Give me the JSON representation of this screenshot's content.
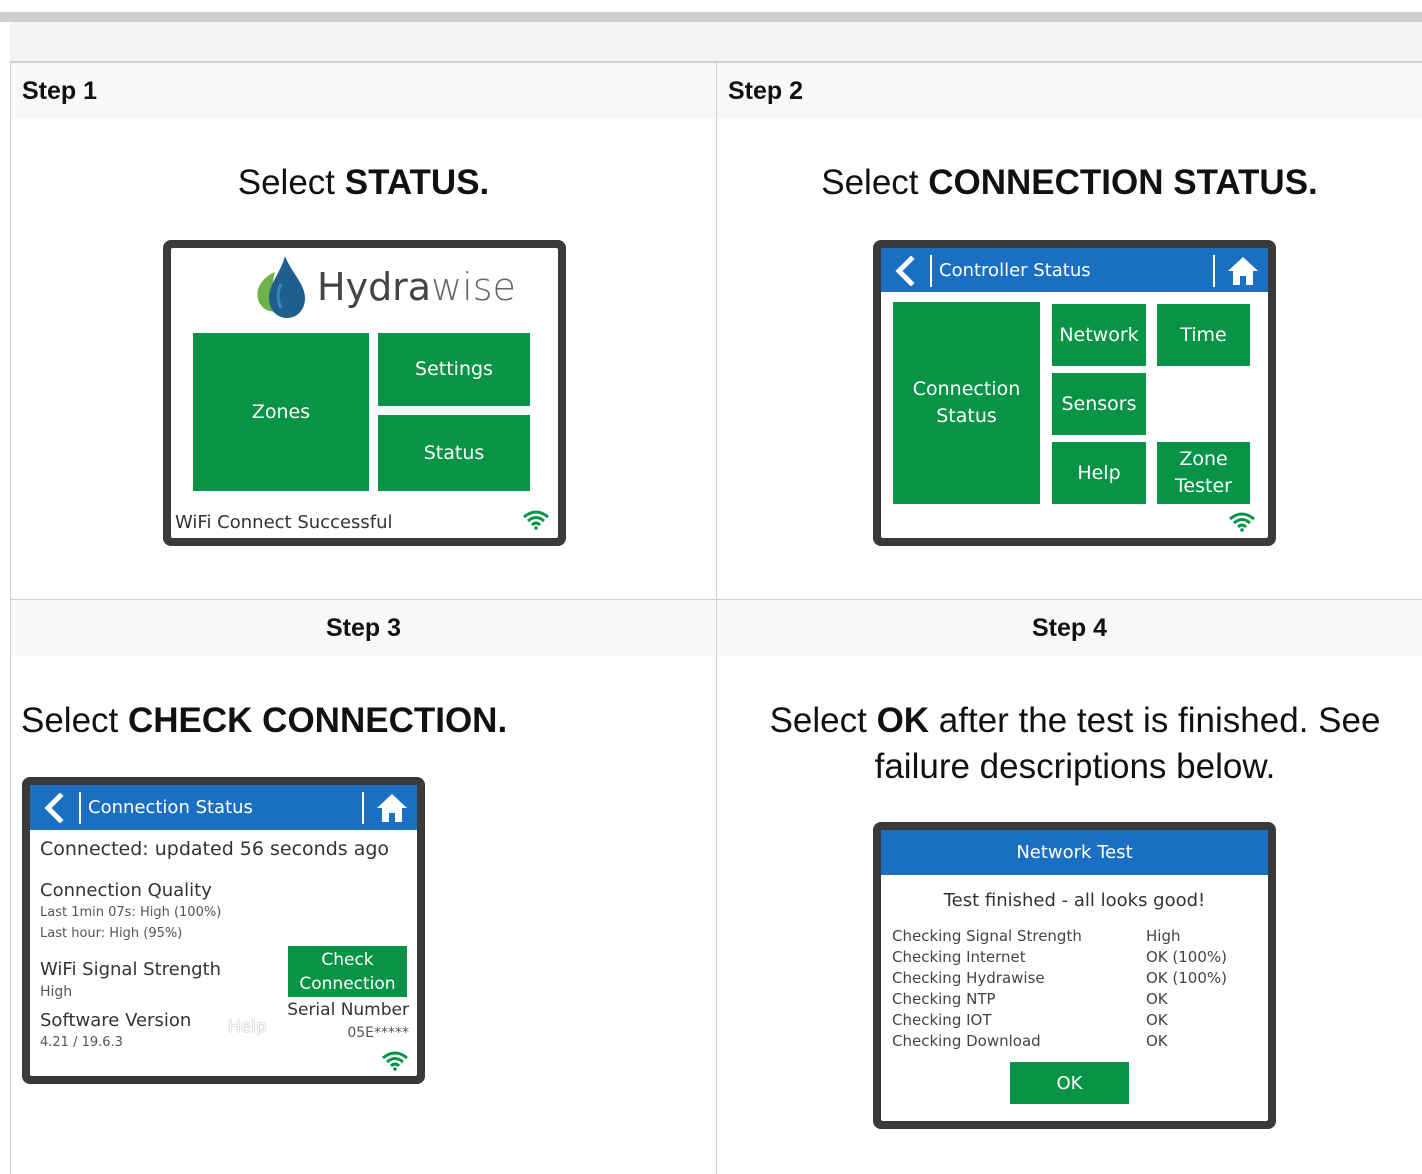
{
  "steps": [
    {
      "header": "Step 1",
      "instruction_prefix": "Select ",
      "instruction_bold": "STATUS.",
      "instruction_suffix": ""
    },
    {
      "header": "Step 2",
      "instruction_prefix": "Select ",
      "instruction_bold": "CONNECTION STATUS.",
      "instruction_suffix": ""
    },
    {
      "header": "Step 3",
      "instruction_prefix": "Select ",
      "instruction_bold": "CHECK CONNECTION.",
      "instruction_suffix": ""
    },
    {
      "header": "Step 4",
      "instruction_prefix": "Select ",
      "instruction_bold": "OK",
      "instruction_suffix": " after the test is finished. See failure descriptions below."
    }
  ],
  "screen_home": {
    "logo_bold": "Hydra",
    "logo_light": "wise",
    "zones": "Zones",
    "settings": "Settings",
    "status": "Status",
    "footer": "WiFi Connect Successful"
  },
  "screen_controller_status": {
    "title": "Controller Status",
    "connection_status_line1": "Connection",
    "connection_status_line2": "Status",
    "network": "Network",
    "time": "Time",
    "sensors": "Sensors",
    "help": "Help",
    "zone_tester_line1": "Zone",
    "zone_tester_line2": "Tester"
  },
  "screen_connection_status": {
    "title": "Connection Status",
    "connected": "Connected: updated 56 seconds ago",
    "quality_label": "Connection Quality",
    "quality_last_min": "Last 1min 07s: High (100%)",
    "quality_last_hour": "Last hour: High (95%)",
    "wifi_label": "WiFi Signal Strength",
    "wifi_value": "High",
    "software_label": "Software Version",
    "software_value": "4.21 / 19.6.3",
    "help": "Help",
    "check_line1": "Check",
    "check_line2": "Connection",
    "serial_label": "Serial Number",
    "serial_value": "05E*****"
  },
  "screen_network_test": {
    "title": "Network Test",
    "result": "Test finished - all looks good!",
    "rows": [
      {
        "check": "Checking Signal Strength",
        "value": "High"
      },
      {
        "check": "Checking Internet",
        "value": "OK (100%)"
      },
      {
        "check": "Checking Hydrawise",
        "value": "OK (100%)"
      },
      {
        "check": "Checking NTP",
        "value": "OK"
      },
      {
        "check": "Checking IOT",
        "value": "OK"
      },
      {
        "check": "Checking Download",
        "value": "OK"
      }
    ],
    "ok": "OK"
  },
  "colors": {
    "green": "#079446",
    "blue": "#1a6fc2",
    "bezel": "#3a3a3a"
  }
}
